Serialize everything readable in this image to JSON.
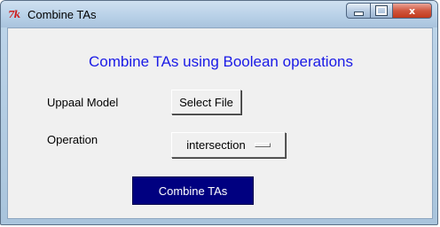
{
  "window": {
    "title": "Combine TAs",
    "icon": "tk-feather-icon",
    "icon_text": "7k",
    "controls": [
      "minimize-icon",
      "maximize-icon",
      "close-icon"
    ],
    "close_glyph": "x"
  },
  "main": {
    "heading": "Combine TAs using Boolean operations",
    "model_label": "Uppaal Model",
    "select_file_label": "Select File",
    "operation_label": "Operation",
    "operation_value": "intersection",
    "combine_label": "Combine TAs"
  },
  "colors": {
    "heading": "#1a1ae6",
    "combine_button_bg": "#000080",
    "combine_button_text": "#ffffff",
    "client_bg": "#f0f0f0"
  }
}
